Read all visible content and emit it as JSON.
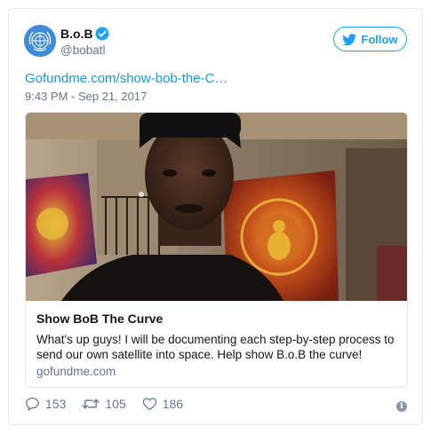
{
  "author": {
    "name": "B.o.B",
    "handle": "@bobatl"
  },
  "follow_label": "Follow",
  "tweet": {
    "link_text": "Gofundme.com/show-bob-the-C…",
    "timestamp": "9:43 PM - Sep 21, 2017"
  },
  "card": {
    "title": "Show BoB The Curve",
    "description": "What's up guys! I will be documenting each step-by-step process to send our own satellite into space. Help show B.o.B the curve!",
    "domain": "gofundme.com"
  },
  "actions": {
    "replies": "153",
    "retweets": "105",
    "likes": "186"
  },
  "colors": {
    "accent": "#1da1f2",
    "link": "#1b95e0",
    "muted": "#657786",
    "border": "#e1e8ed"
  },
  "icons": [
    "un-emblem-avatar",
    "verified-badge-icon",
    "twitter-bird-icon",
    "reply-icon",
    "retweet-icon",
    "heart-icon",
    "info-icon"
  ]
}
